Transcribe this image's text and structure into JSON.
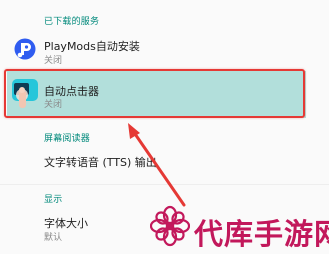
{
  "sections": {
    "downloaded_services": "已下载的服务",
    "screen_reader": "屏幕阅读器",
    "display": "显示"
  },
  "items": {
    "playmods": {
      "title": "PlayMods自动安装",
      "subtitle": "关闭"
    },
    "auto_clicker": {
      "title": "自动点击器",
      "subtitle": "关闭"
    },
    "tts": {
      "title": "文字转语音 (TTS) 输出"
    },
    "font_size": {
      "title": "字体大小",
      "subtitle": "默认"
    }
  },
  "watermark": {
    "text": "代库手游网"
  },
  "colors": {
    "section_header": "#00897b",
    "highlight_row": "#b2dfdb",
    "annotation_red": "#e53935",
    "watermark": "#c2185b"
  }
}
